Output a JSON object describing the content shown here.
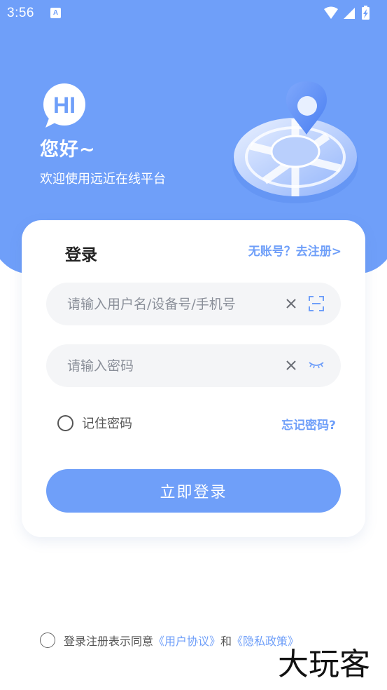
{
  "status_bar": {
    "time": "3:56",
    "notification_letter": "A"
  },
  "header": {
    "logo_text": "HI",
    "greeting": "您好~",
    "subtitle": "欢迎使用远近在线平台"
  },
  "login_card": {
    "title": "登录",
    "register_link": "无账号？去注册>",
    "username_placeholder": "请输入用户名/设备号/手机号",
    "password_placeholder": "请输入密码",
    "remember_label": "记住密码",
    "forgot_link": "忘记密码?",
    "login_button": "立即登录"
  },
  "agreement": {
    "prefix": "登录注册表示同意",
    "user_agreement": "《用户协议》",
    "conjunction": "和",
    "privacy_policy": "《隐私政策》"
  },
  "watermark": {
    "text": "大玩客"
  },
  "icons": {
    "clear": "close-icon",
    "scan": "scan-icon",
    "password_visibility": "eye-closed-icon",
    "wifi": "wifi-icon",
    "signal": "signal-icon",
    "battery": "battery-icon"
  },
  "colors": {
    "primary": "#6f9ff9",
    "background": "#ffffff",
    "field_bg": "#f4f5f7"
  }
}
